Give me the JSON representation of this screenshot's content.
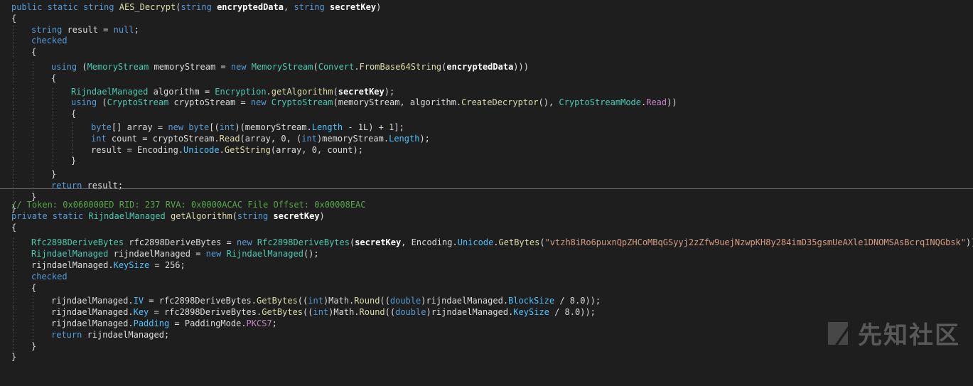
{
  "block1": {
    "sig_mod": "public static ",
    "sig_ret": "string",
    "sig_name": "AES_Decrypt",
    "sig_p1t": "string",
    "sig_p1": "encryptedData",
    "sig_p2t": "string",
    "sig_p2": "secretKey",
    "l3_t": "string",
    "l3_v": " result = ",
    "l3_null": "null",
    "l4": "checked",
    "l6_kw": "using",
    "l6_t": "MemoryStream",
    "l6_v": " memoryStream = ",
    "l6_new": "new",
    "l6_t2": "MemoryStream",
    "l6_c": "Convert",
    "l6_m": "FromBase64String",
    "l6_p": "encryptedData",
    "l8_t": "RijndaelManaged",
    "l8_v": " algorithm = ",
    "l8_c": "Encryption",
    "l8_m": "getAlgorithm",
    "l8_p": "secretKey",
    "l9_kw": "using",
    "l9_t": "CryptoStream",
    "l9_v": " cryptoStream = ",
    "l9_new": "new",
    "l9_t2": "CryptoStream",
    "l9_a": "(memoryStream, algorithm.",
    "l9_m": "CreateDecryptor",
    "l9_b": "(), ",
    "l9_e": "CryptoStreamMode",
    "l9_ev": "Read",
    "l11_kw": "byte",
    "l11_a": "[] array = ",
    "l11_new": "new",
    "l11_kw2": "byte",
    "l11_b": "[(",
    "l11_int": "int",
    "l11_c": ")(memoryStream.",
    "l11_prop": "Length",
    "l11_d": " - 1L) + 1];",
    "l12_int": "int",
    "l12_a": " count = cryptoStream.",
    "l12_m": "Read",
    "l12_b": "(array, 0, (",
    "l12_int2": "int",
    "l12_c": ")memoryStream.",
    "l12_prop": "Length",
    "l12_d": ");",
    "l13_a": "result = Encoding.",
    "l13_prop": "Unicode",
    "l13_dot": ".",
    "l13_m": "GetString",
    "l13_b": "(array, 0, count);",
    "l16_kw": "return",
    "l16_v": " result;"
  },
  "block2": {
    "comment": "// Token: 0x060000ED RID: 237 RVA: 0x0000ACAC File Offset: 0x00008EAC",
    "sig_mod": "private static ",
    "sig_ret": "RijndaelManaged",
    "sig_name": "getAlgorithm",
    "sig_pt": "string",
    "sig_p": "secretKey",
    "l3_t": "Rfc2898DeriveBytes",
    "l3_v": " rfc2898DeriveBytes = ",
    "l3_new": "new",
    "l3_t2": "Rfc2898DeriveBytes",
    "l3_p": "secretKey",
    "l3_a": ", Encoding.",
    "l3_prop": "Unicode",
    "l3_m": "GetBytes",
    "l3_str": "\"vtzh8iRo6puxnQpZHCoMBqGSyyj2zZfw9uejNzwpKH8y284imD35gsmUeAXle1DNOMSAsBcrqINQGbsk\"",
    "l3_end": "));",
    "l4_t": "RijndaelManaged",
    "l4_v": " rijndaelManaged = ",
    "l4_new": "new",
    "l4_t2": "RijndaelManaged",
    "l4_end": "();",
    "l5_a": "rijndaelManaged.",
    "l5_prop": "KeySize",
    "l5_b": " = 256;",
    "l6": "checked",
    "l8_a": "rijndaelManaged.",
    "l8_prop": "IV",
    "l8_b": " = rfc2898DeriveBytes.",
    "l8_m": "GetBytes",
    "l8_c": "((",
    "l8_int": "int",
    "l8_d": ")Math.",
    "l8_m2": "Round",
    "l8_e": "((",
    "l8_dbl": "double",
    "l8_f": ")rijndaelManaged.",
    "l8_prop2": "BlockSize",
    "l8_g": " / 8.0));",
    "l9_a": "rijndaelManaged.",
    "l9_prop": "Key",
    "l9_b": " = rfc2898DeriveBytes.",
    "l9_m": "GetBytes",
    "l9_c": "((",
    "l9_int": "int",
    "l9_d": ")Math.",
    "l9_m2": "Round",
    "l9_e": "((",
    "l9_dbl": "double",
    "l9_f": ")rijndaelManaged.",
    "l9_prop2": "KeySize",
    "l9_g": " / 8.0));",
    "l10_a": "rijndaelManaged.",
    "l10_prop": "Padding",
    "l10_b": " = PaddingMode.",
    "l10_enum": "PKCS7",
    "l10_end": ";",
    "l11_kw": "return",
    "l11_v": " rijndaelManaged;"
  },
  "watermark": {
    "text": "先知社区",
    "logo_icon": "xianzhi-logo-icon"
  }
}
